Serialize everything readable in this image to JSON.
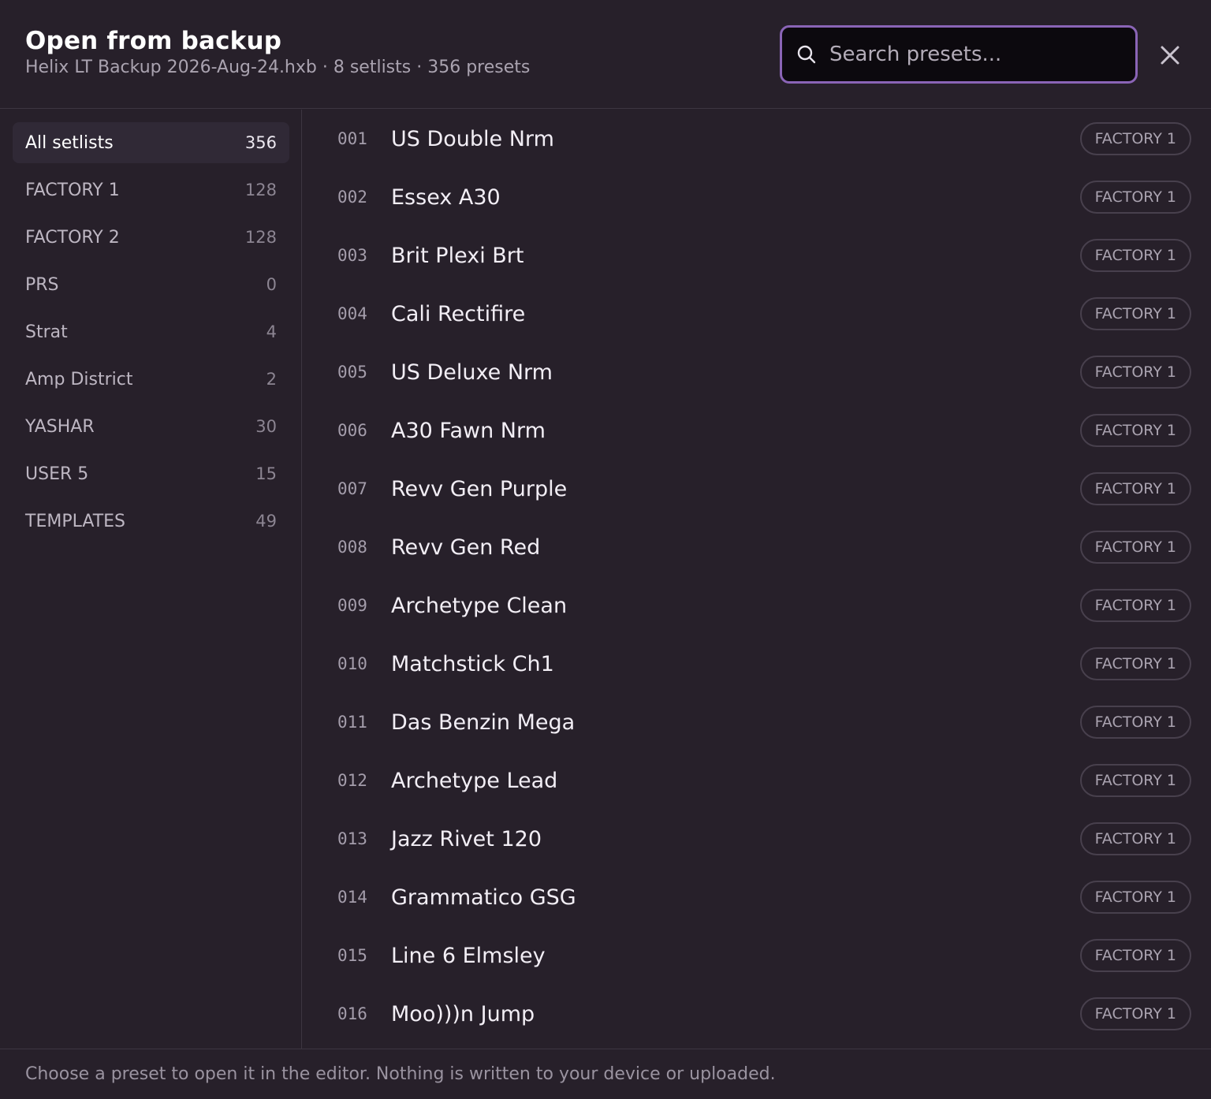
{
  "header": {
    "title": "Open from backup",
    "subtitle": "Helix LT Backup 2026-Aug-24.hxb · 8 setlists · 356 presets"
  },
  "search": {
    "placeholder": "Search presets...",
    "value": "",
    "icon": "search-icon"
  },
  "close": {
    "icon": "close-icon"
  },
  "sidebar": {
    "items": [
      {
        "label": "All setlists",
        "count": "356",
        "active": true
      },
      {
        "label": "FACTORY 1",
        "count": "128"
      },
      {
        "label": "FACTORY 2",
        "count": "128"
      },
      {
        "label": "PRS",
        "count": "0"
      },
      {
        "label": "Strat",
        "count": "4"
      },
      {
        "label": "Amp District",
        "count": "2"
      },
      {
        "label": "YASHAR",
        "count": "30"
      },
      {
        "label": "USER 5",
        "count": "15"
      },
      {
        "label": "TEMPLATES",
        "count": "49"
      }
    ]
  },
  "presets": [
    {
      "num": "001",
      "name": "US Double Nrm",
      "setlist": "FACTORY 1"
    },
    {
      "num": "002",
      "name": "Essex A30",
      "setlist": "FACTORY 1"
    },
    {
      "num": "003",
      "name": "Brit Plexi Brt",
      "setlist": "FACTORY 1"
    },
    {
      "num": "004",
      "name": "Cali Rectifire",
      "setlist": "FACTORY 1"
    },
    {
      "num": "005",
      "name": "US Deluxe Nrm",
      "setlist": "FACTORY 1"
    },
    {
      "num": "006",
      "name": "A30 Fawn Nrm",
      "setlist": "FACTORY 1"
    },
    {
      "num": "007",
      "name": "Revv Gen Purple",
      "setlist": "FACTORY 1"
    },
    {
      "num": "008",
      "name": "Revv Gen Red",
      "setlist": "FACTORY 1"
    },
    {
      "num": "009",
      "name": "Archetype Clean",
      "setlist": "FACTORY 1"
    },
    {
      "num": "010",
      "name": "Matchstick Ch1",
      "setlist": "FACTORY 1"
    },
    {
      "num": "011",
      "name": "Das Benzin Mega",
      "setlist": "FACTORY 1"
    },
    {
      "num": "012",
      "name": "Archetype Lead",
      "setlist": "FACTORY 1"
    },
    {
      "num": "013",
      "name": "Jazz Rivet 120",
      "setlist": "FACTORY 1"
    },
    {
      "num": "014",
      "name": "Grammatico GSG",
      "setlist": "FACTORY 1"
    },
    {
      "num": "015",
      "name": "Line 6 Elmsley",
      "setlist": "FACTORY 1"
    },
    {
      "num": "016",
      "name": "Moo)))n Jump",
      "setlist": "FACTORY 1"
    }
  ],
  "footer": {
    "text": "Choose a preset to open it in the editor. Nothing is written to your device or uploaded."
  },
  "colors": {
    "background": "#27202a",
    "accent": "#8a64b6",
    "search_background": "#0c090e"
  }
}
